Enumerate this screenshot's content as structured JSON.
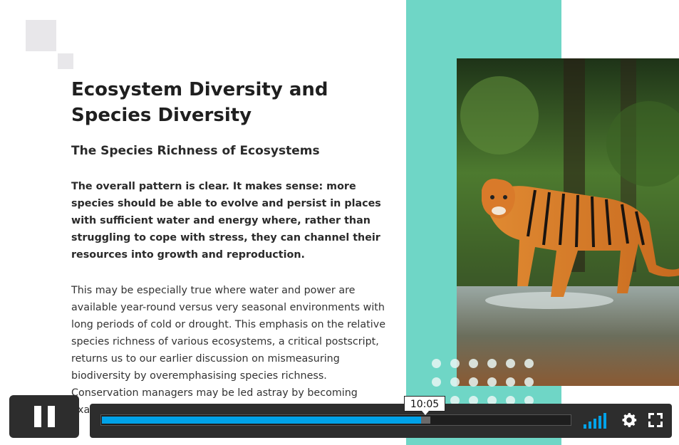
{
  "slide": {
    "title": "Ecosystem Diversity and Species Diversity",
    "subtitle": "The Species Richness of Ecosystems",
    "lead": "The overall pattern is clear. It makes sense: more species should be able to evolve and persist in places with sufficient water and energy where, rather than struggling to cope with stress, they can channel their resources into growth and reproduction.",
    "body": "This may be especially true where water and power are available year-round versus very seasonal environments with long periods of cold or drought. This emphasis on the relative species richness of various ecosystems, a critical postscript, returns us to our earlier discussion on mismeasuring biodiversity by overemphasising species richness. Conservation managers may be led astray by becoming fixated on species richness.",
    "image_subject": "tiger-photo"
  },
  "player": {
    "current_time": "10:05",
    "progress_fraction": 0.68,
    "buffer_fraction": 0.7,
    "volume_level": 1.0,
    "icons": [
      "pause-icon",
      "volume-icon",
      "gear-icon",
      "fullscreen-icon"
    ],
    "accent_color": "#00a2e8"
  },
  "colors": {
    "teal_band": "#6fd6c6",
    "control_bg": "#2d2d2d"
  }
}
